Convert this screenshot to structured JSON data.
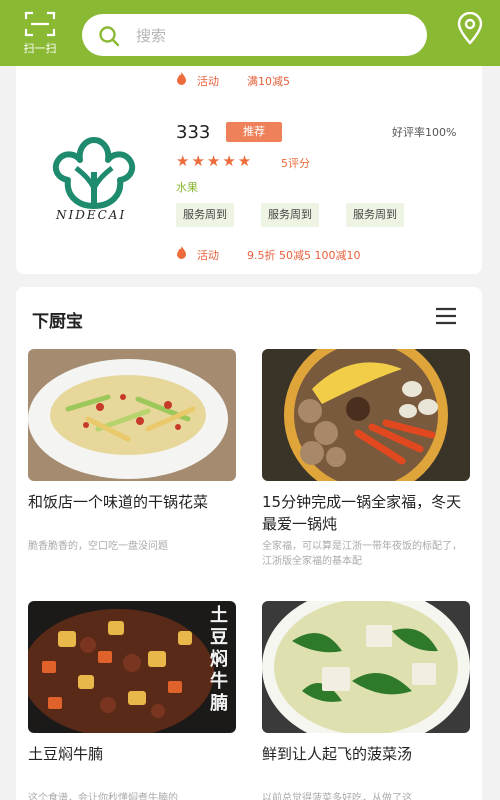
{
  "header": {
    "scan_label": "扫一扫",
    "search_placeholder": "搜索",
    "brand_color": "#8ab934"
  },
  "shop": {
    "prev_activity": {
      "label": "活动",
      "text": "满10减5"
    },
    "logo_text": "NIDECAI",
    "name": "333",
    "badge": "推荐",
    "rating_text": "好评率100%",
    "stars": 5,
    "score_text": "5评分",
    "category": "水果",
    "tags": [
      "服务周到",
      "服务周到",
      "服务周到"
    ],
    "activity": {
      "label": "活动",
      "items": [
        "9.5折",
        "50减5",
        "100减10"
      ]
    }
  },
  "section": {
    "title": "下厨宝",
    "recipes": [
      {
        "title": "和饭店一个味道的干锅花菜",
        "desc": "脆香脆香的，空口吃一盘没问题"
      },
      {
        "title": "15分钟完成一锅全家福，冬天最爱一锅炖",
        "desc": "全家福，可以算是江浙一带年夜饭的标配了，江浙版全家福的基本配"
      },
      {
        "title": "土豆焖牛腩",
        "desc": "这个食谱，会让你秒懂焖煮牛腩的",
        "overlay": "土豆焖牛腩"
      },
      {
        "title": "鲜到让人起飞的菠菜汤",
        "desc": "以前总觉得菠菜多好吃，从做了这"
      }
    ]
  }
}
